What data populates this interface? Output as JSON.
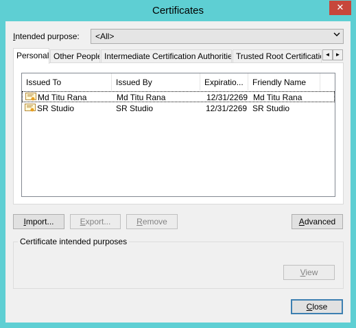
{
  "window": {
    "title": "Certificates",
    "close_glyph": "✕"
  },
  "purpose": {
    "label_underlined": "I",
    "label_rest": "ntended purpose:",
    "value": "<All>",
    "dropdown_icon": "chevron-down-icon"
  },
  "tabs": [
    {
      "label": "Personal"
    },
    {
      "label": "Other People"
    },
    {
      "label": "Intermediate Certification Authorities"
    },
    {
      "label": "Trusted Root Certification"
    }
  ],
  "tab_scroll": {
    "left": "◄",
    "right": "►"
  },
  "list": {
    "columns": [
      "Issued To",
      "Issued By",
      "Expiratio...",
      "Friendly Name"
    ],
    "rows": [
      {
        "issued_to": "Md Titu Rana",
        "issued_by": "Md Titu Rana",
        "expiration": "12/31/2269",
        "friendly_name": "Md Titu Rana"
      },
      {
        "issued_to": "SR Studio",
        "issued_by": "SR Studio",
        "expiration": "12/31/2269",
        "friendly_name": "SR Studio"
      }
    ]
  },
  "buttons": {
    "import_u": "I",
    "import_rest": "mport...",
    "export_u": "E",
    "export_rest": "xport...",
    "remove_u": "R",
    "remove_rest": "emove",
    "advanced_u": "A",
    "advanced_rest": "dvanced",
    "view_u": "V",
    "view_rest": "iew",
    "close_u": "C",
    "close_rest": "lose"
  },
  "group": {
    "label": "Certificate intended purposes"
  },
  "colors": {
    "frame": "#5ecfd3",
    "close_red": "#c7473b",
    "default_button_border": "#3c7fb1"
  }
}
